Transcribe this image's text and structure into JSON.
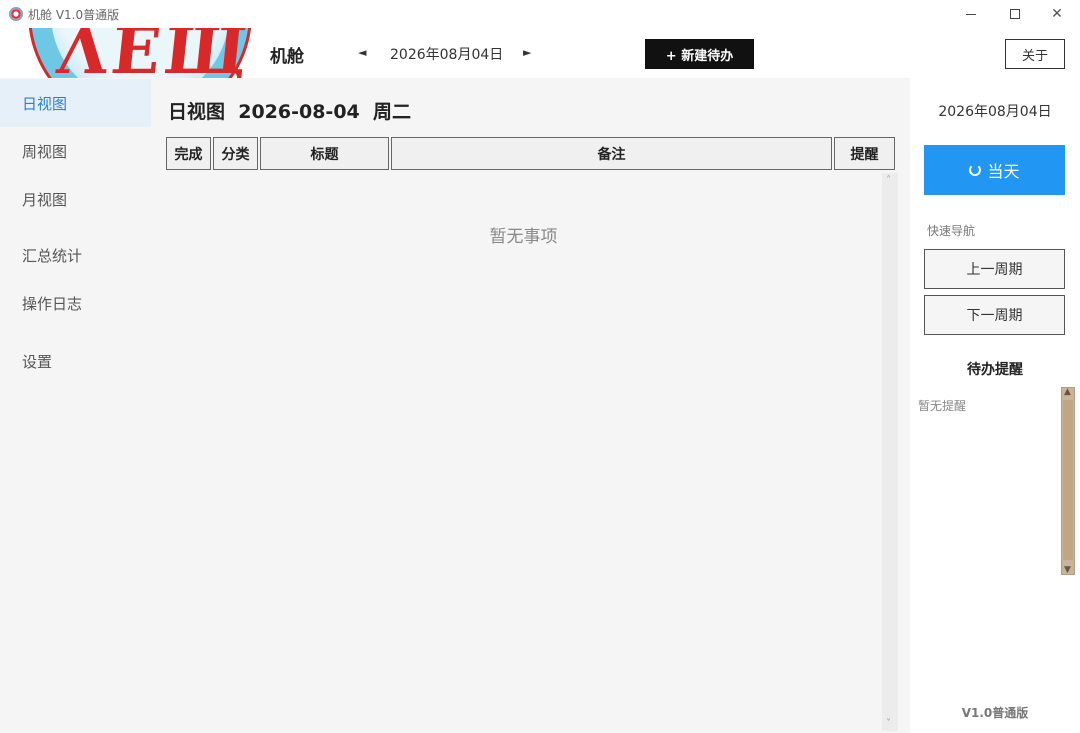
{
  "window": {
    "title": "机舱 V1.0普通版",
    "minimize_icon": "minimize-icon",
    "maximize_icon": "maximize-icon",
    "close_glyph": "✕"
  },
  "header": {
    "brand": "机舱",
    "logo_text": "ΛΕЩ",
    "prev_glyph": "◄",
    "next_glyph": "►",
    "current_date": "2026年08月04日",
    "new_todo_label": "+ 新建待办",
    "about_label": "关于"
  },
  "sidebar": {
    "items": [
      {
        "label": "日视图",
        "active": true
      },
      {
        "label": "周视图",
        "active": false
      },
      {
        "label": "月视图",
        "active": false
      },
      {
        "label": "汇总统计",
        "active": false
      },
      {
        "label": "操作日志",
        "active": false
      },
      {
        "label": "设置",
        "active": false
      }
    ]
  },
  "main": {
    "view_title": "日视图  2026-08-04  周二",
    "columns": [
      "完成",
      "分类",
      "标题",
      "备注",
      "提醒"
    ],
    "empty_text": "暂无事项",
    "scroll_up": "˄",
    "scroll_down": "˅"
  },
  "right": {
    "date": "2026年08月04日",
    "today_label": "当天",
    "quick_nav_label": "快速导航",
    "prev_period_label": "上一周期",
    "next_period_label": "下一周期",
    "reminder_title": "待办提醒",
    "reminder_empty": "暂无提醒",
    "scroll_up": "▲",
    "scroll_down": "▼",
    "version": "V1.0普通版"
  },
  "colors": {
    "accent": "#2196f3",
    "active_nav_text": "#2a7fd4",
    "active_nav_bg": "#e6f0f9",
    "primary_button_bg": "#111111"
  }
}
